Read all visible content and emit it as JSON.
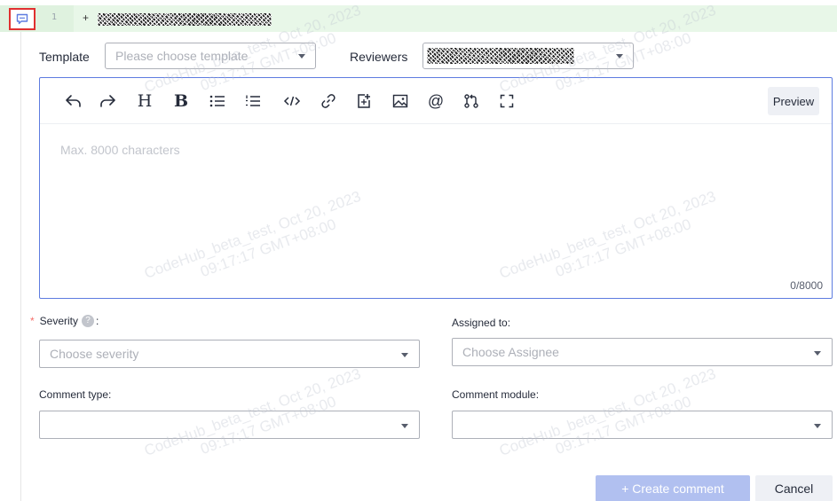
{
  "diff": {
    "line_number": "1",
    "prefix": "+"
  },
  "header": {
    "template_label": "Template",
    "template_placeholder": "Please choose template",
    "reviewers_label": "Reviewers"
  },
  "editor": {
    "toolbar": [
      {
        "name": "undo-icon",
        "glyph": "↶",
        "style": "tb-icon-undo"
      },
      {
        "name": "redo-icon",
        "glyph": "↷"
      },
      {
        "name": "heading-icon",
        "glyph": "H"
      },
      {
        "name": "bold-icon",
        "glyph": "B"
      },
      {
        "name": "bullet-list-icon",
        "glyph": "≔"
      },
      {
        "name": "numbered-list-icon",
        "glyph": "⁝≡"
      },
      {
        "name": "code-icon",
        "glyph": "</>"
      },
      {
        "name": "link-icon",
        "glyph": "🔗"
      },
      {
        "name": "add-file-icon",
        "glyph": "+"
      },
      {
        "name": "image-icon",
        "glyph": "img"
      },
      {
        "name": "mention-icon",
        "glyph": "@"
      },
      {
        "name": "merge-request-icon",
        "glyph": "mr"
      },
      {
        "name": "fullscreen-icon",
        "glyph": "[ ]"
      }
    ],
    "preview_label": "Preview",
    "placeholder": "Max. 8000 characters",
    "char_count": "0/8000"
  },
  "form": {
    "severity_label": "Severity",
    "severity_colon": ":",
    "severity_placeholder": "Choose severity",
    "assigned_label": "Assigned to:",
    "assigned_placeholder": "Choose Assignee",
    "comment_type_label": "Comment type:",
    "comment_type_value": "",
    "comment_module_label": "Comment module:",
    "comment_module_value": ""
  },
  "actions": {
    "create_label": "+ Create comment",
    "cancel_label": "Cancel"
  },
  "watermark": {
    "line1": "CodeHub_beta_test, Oct 20, 2023",
    "line2": "09:17:17 GMT+08:00"
  },
  "colors": {
    "accent": "#5e7ce0",
    "disabled_primary": "#b1c0f0",
    "added_line_bg": "#e8f7e8",
    "highlight_border": "#e03030",
    "required": "#f66f6a"
  }
}
